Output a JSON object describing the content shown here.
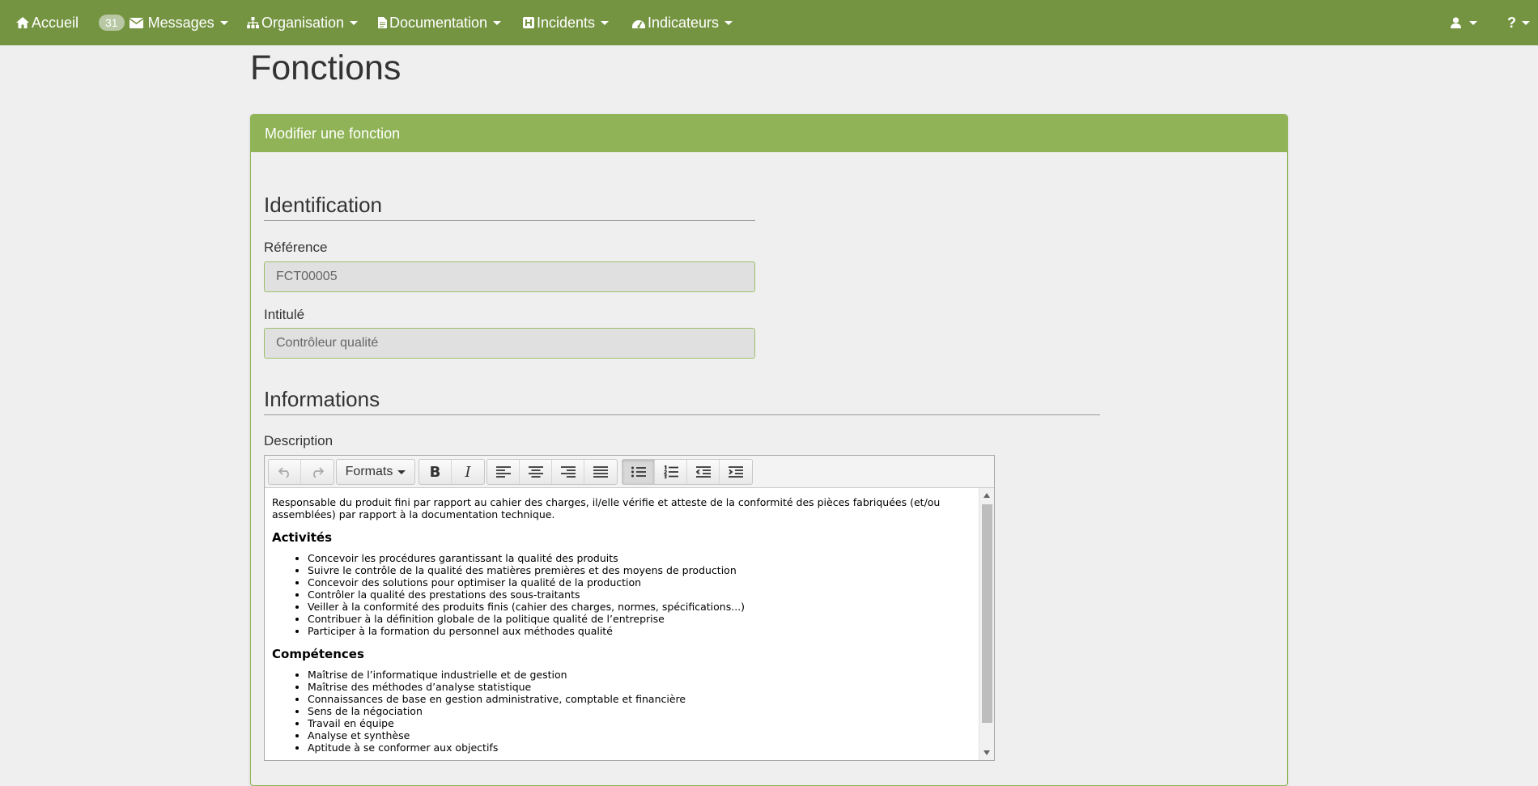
{
  "nav": {
    "home": "Accueil",
    "messages_count": "31",
    "messages": "Messages",
    "organisation": "Organisation",
    "documentation": "Documentation",
    "incidents": "Incidents",
    "indicateurs": "Indicateurs"
  },
  "page": {
    "title": "Fonctions",
    "panel_title": "Modifier une fonction"
  },
  "identification": {
    "section": "Identification",
    "reference_label": "Référence",
    "reference_value": "FCT00005",
    "intitule_label": "Intitulé",
    "intitule_value": "Contrôleur qualité"
  },
  "informations": {
    "section": "Informations",
    "description_label": "Description"
  },
  "toolbar": {
    "formats": "Formats",
    "bold": "B",
    "italic": "I"
  },
  "editor": {
    "intro": "Responsable du produit fini par rapport au cahier des charges, il/elle vérifie et atteste de la conformité des pièces fabriquées (et/ou assemblées) par rapport à la documentation technique.",
    "activites_title": "Activités",
    "activites": [
      "Concevoir les procédures garantissant la qualité des produits",
      "Suivre le contrôle de la qualité des matières premières et des moyens de production",
      "Concevoir des solutions pour optimiser la qualité de la production",
      "Contrôler la qualité des prestations des sous-traitants",
      "Veiller à la conformité des produits finis (cahier des charges, normes, spécifications...)",
      "Contribuer à la définition globale de la politique qualité de l’entreprise",
      "Participer à la formation du personnel aux méthodes qualité"
    ],
    "competences_title": "Compétences",
    "competences": [
      "Maîtrise de l’informatique industrielle et de gestion",
      "Maîtrise des méthodes d’analyse statistique",
      "Connaissances de base en gestion administrative, comptable et financière",
      "Sens de la négociation",
      "Travail en équipe",
      "Analyse et synthèse",
      "Aptitude à se conformer aux objectifs"
    ]
  }
}
